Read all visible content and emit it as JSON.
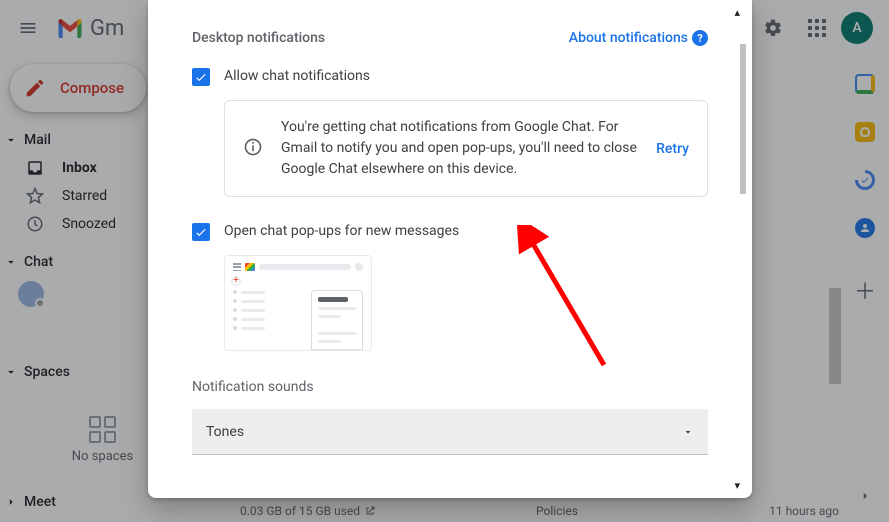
{
  "topbar": {
    "product": "Gm",
    "avatar_initial": "A",
    "keyboard_dropdown": "▾"
  },
  "sidebar": {
    "compose": "Compose",
    "sections": {
      "mail": "Mail",
      "chat": "Chat",
      "spaces": "Spaces",
      "meet": "Meet"
    },
    "items": {
      "inbox": "Inbox",
      "starred": "Starred",
      "snoozed": "Snoozed"
    },
    "no_spaces": "No spaces"
  },
  "footer": {
    "storage": "0.03 GB of 15 GB used",
    "policies": "Policies",
    "activity": "11 hours ago"
  },
  "dialog": {
    "title": "Desktop notifications",
    "about": "About notifications",
    "allow_chat": "Allow chat notifications",
    "alert_msg": "You're getting chat notifications from Google Chat. For Gmail to notify you and open pop-ups, you'll need to close Google Chat elsewhere on this device.",
    "retry": "Retry",
    "open_popups": "Open chat pop-ups for new messages",
    "sounds_label": "Notification sounds",
    "sounds_value": "Tones"
  }
}
